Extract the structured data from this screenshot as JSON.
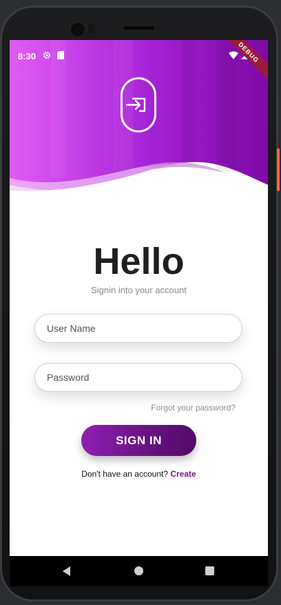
{
  "status_bar": {
    "time": "8:30",
    "icons": [
      "gear-icon",
      "sim-card-icon",
      "wifi-icon",
      "signal-icon"
    ],
    "debug_banner": "DEBUG"
  },
  "header": {
    "logo_icon": "login-icon",
    "gradient": [
      "#e25cf7",
      "#a521d6",
      "#7e0aa6"
    ]
  },
  "main": {
    "title": "Hello",
    "subtitle": "Signin into your account",
    "username": {
      "placeholder": "User Name",
      "value": ""
    },
    "password": {
      "placeholder": "Password",
      "value": ""
    },
    "forgot_label": "Forgot your password?",
    "signin_label": "SIGN IN",
    "no_account_text": "Don't have an account?",
    "create_label": "Create"
  },
  "navbar": {
    "icons": [
      "back-icon",
      "home-icon",
      "recents-icon"
    ]
  },
  "colors": {
    "accent": "#7b158f",
    "button_start": "#8f1eb0",
    "button_end": "#520a67"
  }
}
